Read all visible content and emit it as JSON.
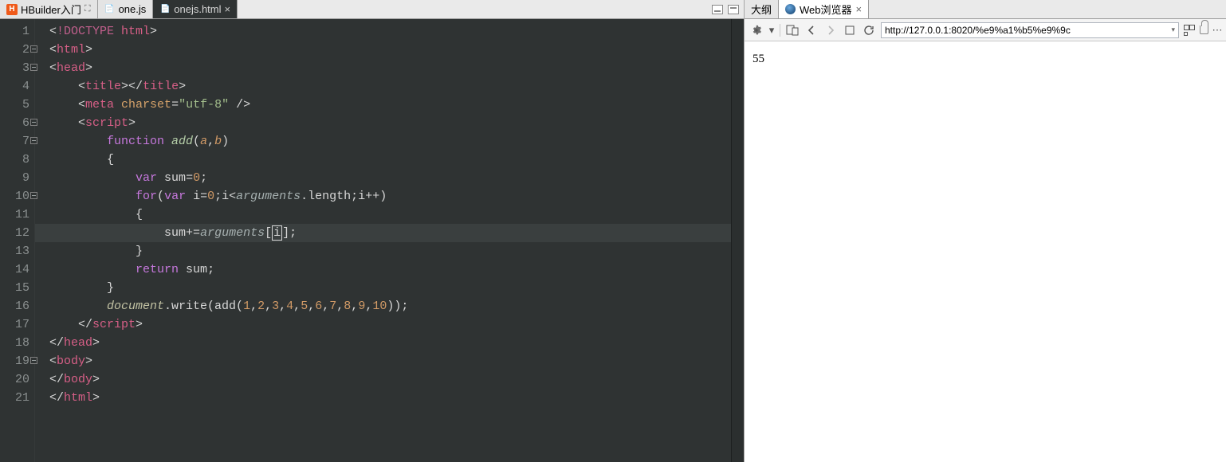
{
  "editor": {
    "tabs": [
      {
        "label": "HBuilder入门",
        "iconLetter": "H",
        "iconClass": "h",
        "pinned": true,
        "active": false
      },
      {
        "label": "one.js",
        "iconLetter": "JS",
        "iconClass": "js",
        "pinned": false,
        "active": false
      },
      {
        "label": "onejs.html",
        "iconLetter": "⧉",
        "iconClass": "html",
        "pinned": false,
        "active": true
      }
    ],
    "code": {
      "lines": [
        {
          "n": 1,
          "fold": false,
          "tokens": [
            [
              "t-angle",
              "<"
            ],
            [
              "t-doctype",
              "!DOCTYPE "
            ],
            [
              "t-tag2",
              "html"
            ],
            [
              "t-angle",
              ">"
            ]
          ]
        },
        {
          "n": 2,
          "fold": true,
          "tokens": [
            [
              "t-angle",
              "<"
            ],
            [
              "t-tag2",
              "html"
            ],
            [
              "t-angle",
              ">"
            ]
          ]
        },
        {
          "n": 3,
          "fold": true,
          "tokens": [
            [
              "t-angle",
              "<"
            ],
            [
              "t-tag2",
              "head"
            ],
            [
              "t-angle",
              ">"
            ]
          ]
        },
        {
          "n": 4,
          "fold": false,
          "indent": 1,
          "tokens": [
            [
              "t-angle",
              "<"
            ],
            [
              "t-tag2",
              "title"
            ],
            [
              "t-angle",
              "></"
            ],
            [
              "t-tag2",
              "title"
            ],
            [
              "t-angle",
              ">"
            ]
          ]
        },
        {
          "n": 5,
          "fold": false,
          "indent": 1,
          "tokens": [
            [
              "t-angle",
              "<"
            ],
            [
              "t-tag2",
              "meta "
            ],
            [
              "t-attr",
              "charset"
            ],
            [
              "t-op",
              "="
            ],
            [
              "t-str",
              "\"utf-8\""
            ],
            [
              "t-angle",
              " />"
            ]
          ]
        },
        {
          "n": 6,
          "fold": true,
          "indent": 1,
          "tokens": [
            [
              "t-angle",
              "<"
            ],
            [
              "t-tag2",
              "script"
            ],
            [
              "t-angle",
              ">"
            ]
          ]
        },
        {
          "n": 7,
          "fold": true,
          "indent": 2,
          "tokens": [
            [
              "t-kw",
              "function "
            ],
            [
              "t-fn",
              "add"
            ],
            [
              "t-op",
              "("
            ],
            [
              "t-param",
              "a"
            ],
            [
              "t-op",
              ","
            ],
            [
              "t-param",
              "b"
            ],
            [
              "t-op",
              ")"
            ]
          ]
        },
        {
          "n": 8,
          "fold": false,
          "indent": 2,
          "tokens": [
            [
              "t-op",
              "{"
            ]
          ]
        },
        {
          "n": 9,
          "fold": false,
          "indent": 3,
          "tokens": [
            [
              "t-kw",
              "var "
            ],
            [
              "t-var",
              "sum"
            ],
            [
              "t-op",
              "="
            ],
            [
              "t-num",
              "0"
            ],
            [
              "t-op",
              ";"
            ]
          ]
        },
        {
          "n": 10,
          "fold": true,
          "indent": 3,
          "tokens": [
            [
              "t-kw",
              "for"
            ],
            [
              "t-op",
              "("
            ],
            [
              "t-kw",
              "var "
            ],
            [
              "t-var",
              "i"
            ],
            [
              "t-op",
              "="
            ],
            [
              "t-num",
              "0"
            ],
            [
              "t-op",
              ";i"
            ],
            [
              "t-op",
              "<"
            ],
            [
              "t-builtin",
              "arguments"
            ],
            [
              "t-op",
              ".length;i"
            ],
            [
              "t-op",
              "++"
            ],
            [
              "t-op",
              ")"
            ]
          ]
        },
        {
          "n": 11,
          "fold": false,
          "indent": 3,
          "tokens": [
            [
              "t-op",
              "{"
            ]
          ]
        },
        {
          "n": 12,
          "fold": false,
          "indent": 4,
          "hl": true,
          "tokens": [
            [
              "t-var",
              "sum"
            ],
            [
              "t-op",
              "+="
            ],
            [
              "t-builtin",
              "arguments"
            ],
            [
              "t-op",
              "["
            ],
            [
              "t-cursor",
              "i"
            ],
            [
              "t-op",
              "];"
            ]
          ]
        },
        {
          "n": 13,
          "fold": false,
          "indent": 3,
          "tokens": [
            [
              "t-op",
              "}"
            ]
          ]
        },
        {
          "n": 14,
          "fold": false,
          "indent": 3,
          "tokens": [
            [
              "t-kw",
              "return "
            ],
            [
              "t-var",
              "sum"
            ],
            [
              "t-op",
              ";"
            ]
          ]
        },
        {
          "n": 15,
          "fold": false,
          "indent": 2,
          "tokens": [
            [
              "t-op",
              "}"
            ]
          ]
        },
        {
          "n": 16,
          "fold": false,
          "indent": 2,
          "tokens": [
            [
              "t-fn2",
              "document"
            ],
            [
              "t-op",
              ".write(add("
            ],
            [
              "t-num",
              "1"
            ],
            [
              "t-op",
              ","
            ],
            [
              "t-num",
              "2"
            ],
            [
              "t-op",
              ","
            ],
            [
              "t-num",
              "3"
            ],
            [
              "t-op",
              ","
            ],
            [
              "t-num",
              "4"
            ],
            [
              "t-op",
              ","
            ],
            [
              "t-num",
              "5"
            ],
            [
              "t-op",
              ","
            ],
            [
              "t-num",
              "6"
            ],
            [
              "t-op",
              ","
            ],
            [
              "t-num",
              "7"
            ],
            [
              "t-op",
              ","
            ],
            [
              "t-num",
              "8"
            ],
            [
              "t-op",
              ","
            ],
            [
              "t-num",
              "9"
            ],
            [
              "t-op",
              ","
            ],
            [
              "t-num",
              "10"
            ],
            [
              "t-op",
              "));"
            ]
          ]
        },
        {
          "n": 17,
          "fold": false,
          "indent": 1,
          "tokens": [
            [
              "t-angle",
              "</"
            ],
            [
              "t-tag2",
              "script"
            ],
            [
              "t-angle",
              ">"
            ]
          ]
        },
        {
          "n": 18,
          "fold": false,
          "tokens": [
            [
              "t-angle",
              "</"
            ],
            [
              "t-tag2",
              "head"
            ],
            [
              "t-angle",
              ">"
            ]
          ]
        },
        {
          "n": 19,
          "fold": true,
          "tokens": [
            [
              "t-angle",
              "<"
            ],
            [
              "t-tag2",
              "body"
            ],
            [
              "t-angle",
              ">"
            ]
          ]
        },
        {
          "n": 20,
          "fold": false,
          "tokens": [
            [
              "t-angle",
              "</"
            ],
            [
              "t-tag2",
              "body"
            ],
            [
              "t-angle",
              ">"
            ]
          ]
        },
        {
          "n": 21,
          "fold": false,
          "tokens": [
            [
              "t-angle",
              "</"
            ],
            [
              "t-tag2",
              "html"
            ],
            [
              "t-angle",
              ">"
            ]
          ]
        }
      ]
    }
  },
  "right": {
    "tabs": [
      {
        "label": "大纲",
        "active": false,
        "icon": "outline"
      },
      {
        "label": "Web浏览器",
        "active": true,
        "icon": "globe"
      }
    ],
    "toolbar": {
      "url": "http://127.0.0.1:8020/%e9%a1%b5%e9%9c"
    },
    "page_output": "55"
  }
}
